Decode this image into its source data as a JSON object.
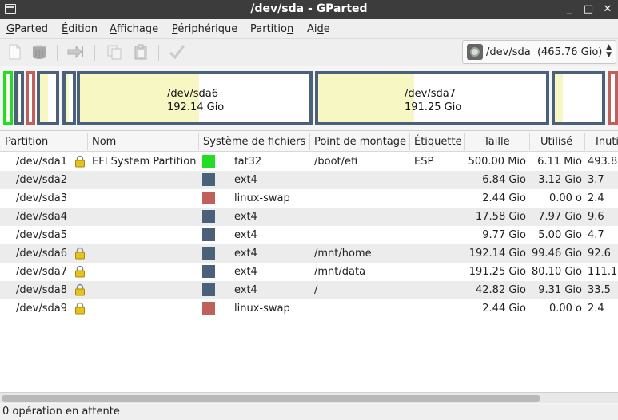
{
  "window": {
    "title": "/dev/sda - GParted",
    "app_icon": "gparted-window-icon",
    "minimize": "_",
    "maximize": "□",
    "close": "✕"
  },
  "menu": [
    {
      "pre": "",
      "u": "G",
      "post": "Parted"
    },
    {
      "pre": "",
      "u": "É",
      "post": "dition"
    },
    {
      "pre": "",
      "u": "A",
      "post": "ffichage"
    },
    {
      "pre": "",
      "u": "P",
      "post": "ériphérique"
    },
    {
      "pre": "Partitio",
      "u": "n",
      "post": ""
    },
    {
      "pre": "Ai",
      "u": "d",
      "post": "e"
    }
  ],
  "toolbar": {
    "icons": [
      "new-icon",
      "delete-icon",
      "resize-move-icon",
      "copy-icon",
      "paste-icon",
      "apply-icon"
    ]
  },
  "device_selector": {
    "value": "/dev/sda  (465.76 Gio)",
    "icon": "disk-icon",
    "arrows": "▲▼"
  },
  "partition_map": {
    "sda6": {
      "name": "/dev/sda6",
      "size": "192.14 Gio"
    },
    "sda7": {
      "name": "/dev/sda7",
      "size": "191.25 Gio"
    }
  },
  "colors": {
    "fat32": "#22dd22",
    "ext4": "#4a6179",
    "linux_swap": "#c0605a",
    "used": "#f7f7c3",
    "selected_row": "#ececec"
  },
  "table": {
    "headers": [
      "Partition",
      "Nom",
      "Système de fichiers",
      "Point de montage",
      "Étiquette",
      "Taille",
      "Utilisé",
      "Inuti"
    ],
    "rows": [
      {
        "partition": "/dev/sda1",
        "lock": true,
        "name": "EFI System Partition",
        "fs": "fat32",
        "mount": "/boot/efi",
        "label": "ESP",
        "size": "500.00 Mio",
        "used": "6.11 Mio",
        "unused": "493.8"
      },
      {
        "partition": "/dev/sda2",
        "lock": false,
        "name": "",
        "fs": "ext4",
        "mount": "",
        "label": "",
        "size": "6.84 Gio",
        "used": "3.12 Gio",
        "unused": "3.7"
      },
      {
        "partition": "/dev/sda3",
        "lock": false,
        "name": "",
        "fs": "linux-swap",
        "mount": "",
        "label": "",
        "size": "2.44 Gio",
        "used": "0.00 o",
        "unused": "2.4"
      },
      {
        "partition": "/dev/sda4",
        "lock": false,
        "name": "",
        "fs": "ext4",
        "mount": "",
        "label": "",
        "size": "17.58 Gio",
        "used": "7.97 Gio",
        "unused": "9.6"
      },
      {
        "partition": "/dev/sda5",
        "lock": false,
        "name": "",
        "fs": "ext4",
        "mount": "",
        "label": "",
        "size": "9.77 Gio",
        "used": "5.00 Gio",
        "unused": "4.7"
      },
      {
        "partition": "/dev/sda6",
        "lock": true,
        "name": "",
        "fs": "ext4",
        "mount": "/mnt/home",
        "label": "",
        "size": "192.14 Gio",
        "used": "99.46 Gio",
        "unused": "92.6"
      },
      {
        "partition": "/dev/sda7",
        "lock": true,
        "name": "",
        "fs": "ext4",
        "mount": "/mnt/data",
        "label": "",
        "size": "191.25 Gio",
        "used": "80.10 Gio",
        "unused": "111.1"
      },
      {
        "partition": "/dev/sda8",
        "lock": true,
        "name": "",
        "fs": "ext4",
        "mount": "/",
        "label": "",
        "size": "42.82 Gio",
        "used": "9.31 Gio",
        "unused": "33.5"
      },
      {
        "partition": "/dev/sda9",
        "lock": true,
        "name": "",
        "fs": "linux-swap",
        "mount": "",
        "label": "",
        "size": "2.44 Gio",
        "used": "0.00 o",
        "unused": "2.4"
      }
    ]
  },
  "status": "0 opération en attente"
}
